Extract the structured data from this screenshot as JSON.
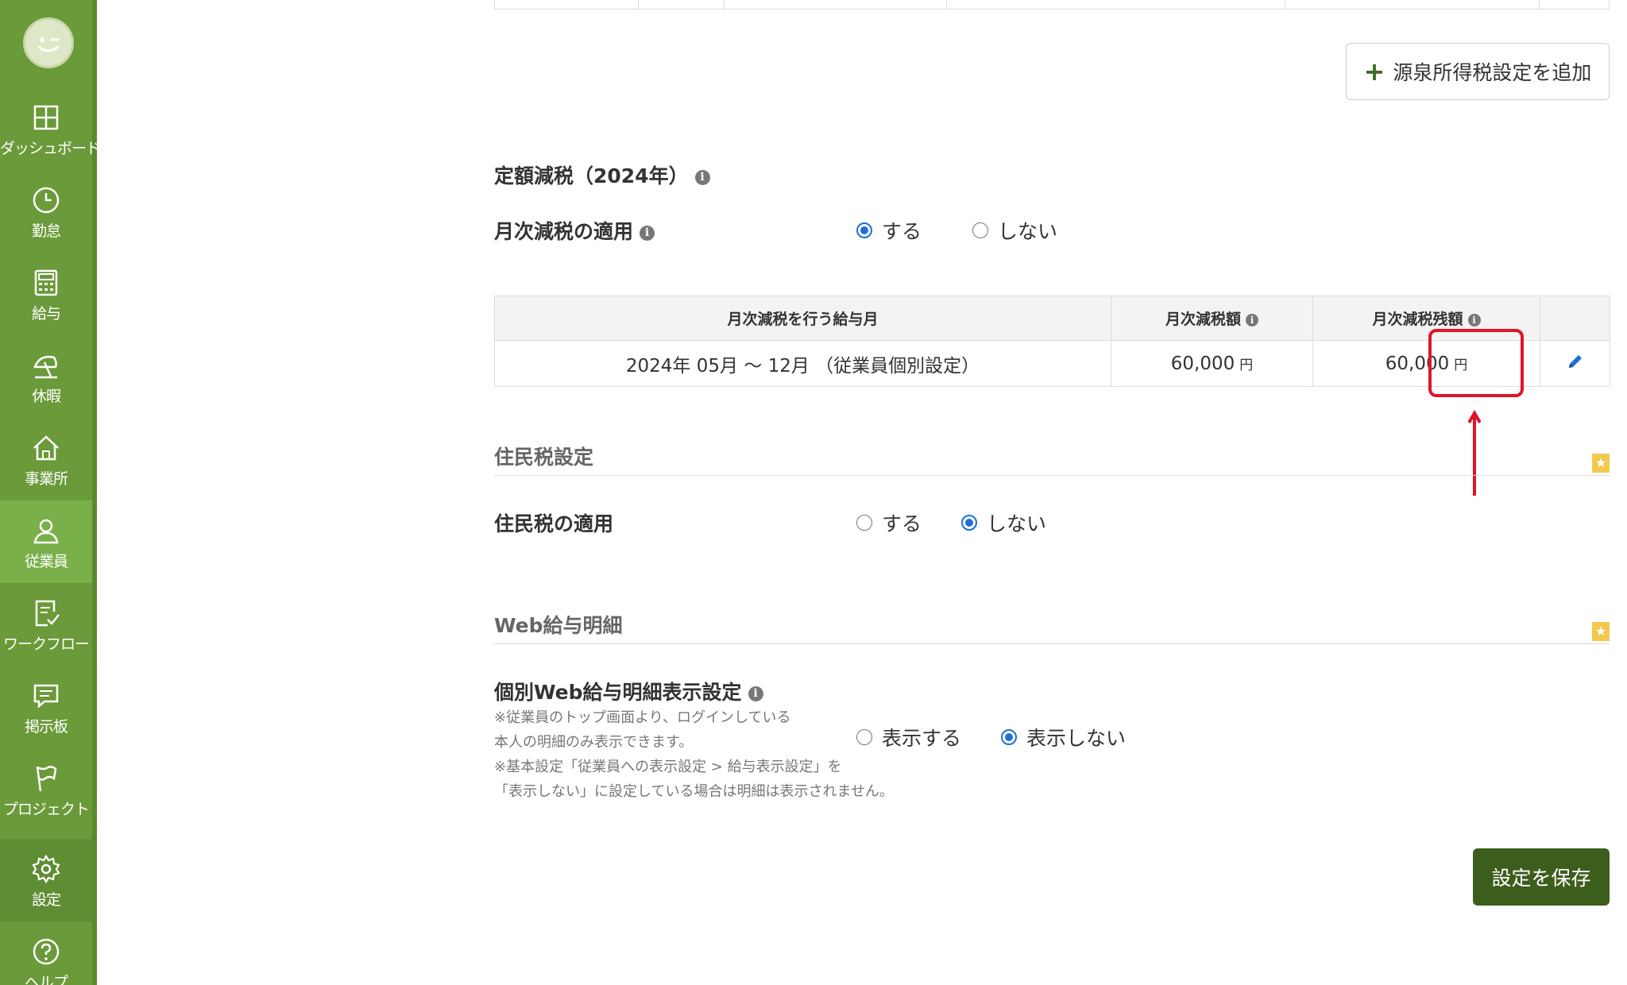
{
  "sidebar": {
    "items": [
      {
        "label": "ダッシュボード",
        "icon": "dashboard-icon"
      },
      {
        "label": "勤怠",
        "icon": "clock-icon"
      },
      {
        "label": "給与",
        "icon": "calculator-icon"
      },
      {
        "label": "休暇",
        "icon": "beach-umbrella-icon"
      },
      {
        "label": "事業所",
        "icon": "home-icon"
      },
      {
        "label": "従業員",
        "icon": "person-icon",
        "active": true
      },
      {
        "label": "ワークフロー",
        "icon": "checklist-icon"
      },
      {
        "label": "掲示板",
        "icon": "chat-icon"
      },
      {
        "label": "プロジェクト",
        "icon": "flag-icon"
      },
      {
        "label": "設定",
        "icon": "gear-icon"
      },
      {
        "label": "ヘルプ",
        "icon": "help-icon"
      }
    ]
  },
  "add_withholding_button": "源泉所得税設定を追加",
  "fixed_tax_reduction": {
    "title": "定額減税（2024年）",
    "monthly_label": "月次減税の適用",
    "options": [
      "する",
      "しない"
    ],
    "selected": "する",
    "table": {
      "headers": [
        "月次減税を行う給与月",
        "月次減税額",
        "月次減税残額",
        ""
      ],
      "rows": [
        {
          "period": "2024年 05月 〜 12月 （従業員個別設定）",
          "amount": "60,000",
          "remaining": "60,000",
          "unit": "円"
        }
      ]
    }
  },
  "resident_tax": {
    "section_title": "住民税設定",
    "label": "住民税の適用",
    "options": [
      "する",
      "しない"
    ],
    "selected": "しない"
  },
  "web_payslip": {
    "section_title": "Web給与明細",
    "label": "個別Web給与明細表示設定",
    "notes": [
      "※従業員のトップ画面より、ログインしている",
      "本人の明細のみ表示できます。",
      "※基本設定「従業員への表示設定 > 給与表示設定」を",
      "「表示しない」に設定している場合は明細は表示されません。"
    ],
    "options": [
      "表示する",
      "表示しない"
    ],
    "selected": "表示しない"
  },
  "save_button": "設定を保存",
  "colors": {
    "sidebar": "#6a9a39",
    "sidebar_active": "#7ab04a",
    "save_button": "#3c5e1c",
    "radio_checked": "#1e6fd9",
    "highlight": "#e0142a",
    "star_badge": "#f2c94c"
  }
}
